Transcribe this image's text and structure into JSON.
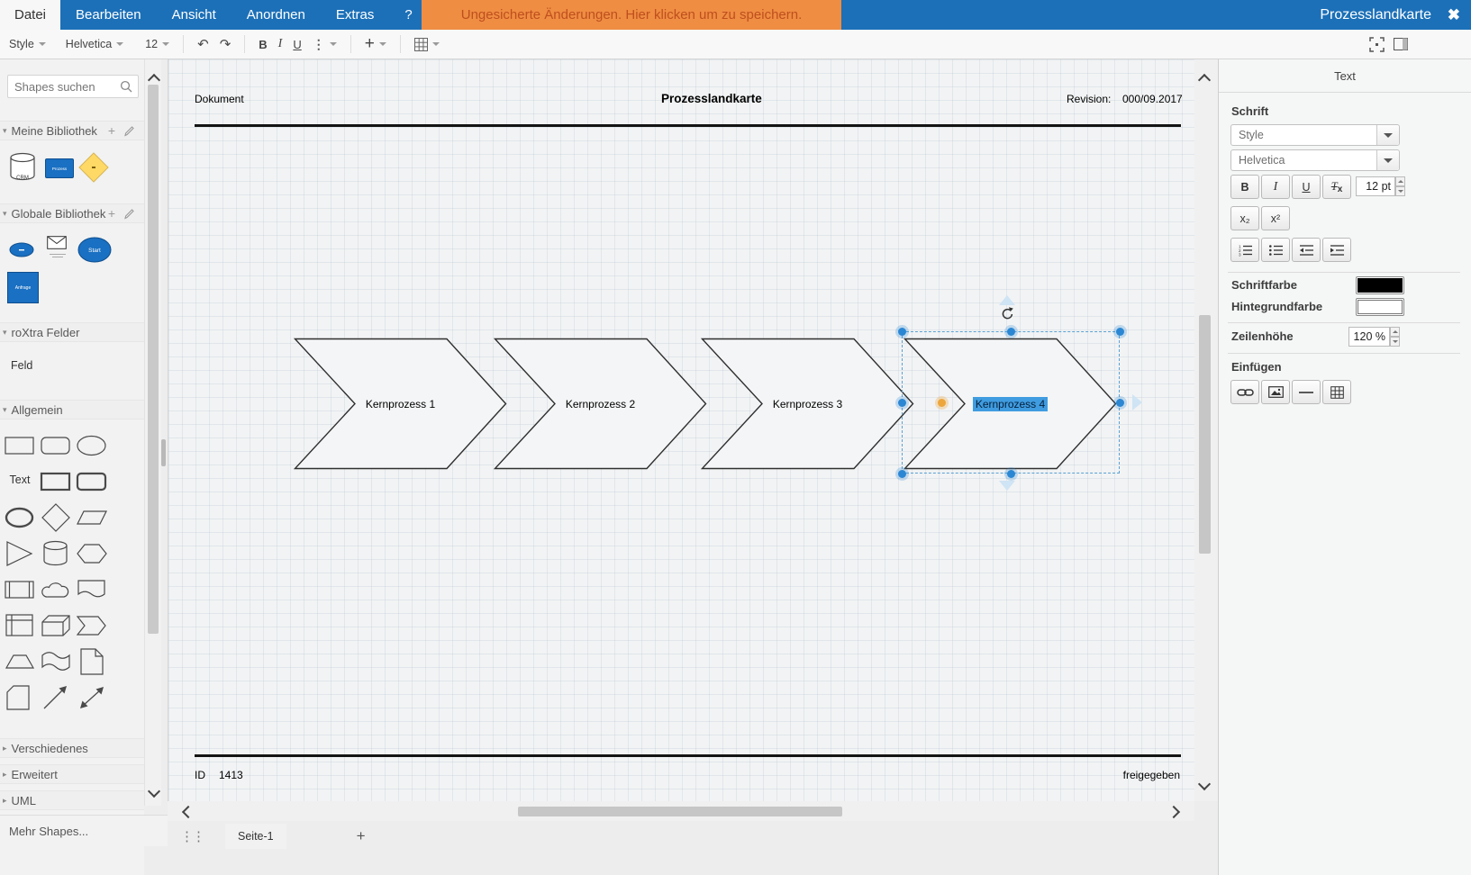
{
  "menu": {
    "datei": "Datei",
    "bearbeiten": "Bearbeiten",
    "ansicht": "Ansicht",
    "anordnen": "Anordnen",
    "extras": "Extras",
    "help": "?"
  },
  "warning": "Ungesicherte Änderungen. Hier klicken um zu speichern.",
  "window_title": "Prozesslandkarte",
  "toolbar": {
    "style": "Style",
    "font": "Helvetica",
    "size": "12",
    "bold": "B",
    "italic": "I",
    "underline": "U"
  },
  "sidebar": {
    "search_placeholder": "Shapes suchen",
    "sections": {
      "meine": "Meine Bibliothek",
      "globale": "Globale Bibliothek",
      "roxtra": "roXtra Felder",
      "allgemein": "Allgemein",
      "verschiedenes": "Verschiedenes",
      "erweitert": "Erweitert",
      "uml": "UML"
    },
    "feld": "Feld",
    "mehr_shapes": "Mehr Shapes...",
    "text_shape": "Text",
    "library_labels": {
      "crm": "CRM",
      "prozess": "Prozess",
      "start": "Start",
      "anfrage": "Anfrage"
    },
    "allgemein_shapes": [
      "rectangle",
      "rounded-rectangle",
      "ellipse",
      "text",
      "rectangle-bold",
      "rounded-rectangle-bold",
      "ellipse-bold",
      "diamond",
      "parallelogram",
      "triangle",
      "cylinder",
      "hexagon",
      "process",
      "cloud",
      "document",
      "internal-storage",
      "cube",
      "step",
      "trapezoid",
      "tape",
      "note",
      "card",
      "arrow",
      "bidirectional-arrow"
    ]
  },
  "canvas": {
    "doc_label": "Dokument",
    "title": "Prozesslandkarte",
    "revision_label": "Revision:",
    "revision_value": "000/09.2017",
    "id_label": "ID",
    "id_value": "1413",
    "status": "freigegeben",
    "chevrons": [
      {
        "label": "Kernprozess 1"
      },
      {
        "label": "Kernprozess 2"
      },
      {
        "label": "Kernprozess 3"
      },
      {
        "label": "Kernprozess 4",
        "selected": true
      }
    ]
  },
  "pages": {
    "tab": "Seite-1",
    "add": "+"
  },
  "panel": {
    "title": "Text",
    "schrift": "Schrift",
    "style_value": "Style",
    "font_value": "Helvetica",
    "size_value": "12 pt",
    "bold": "B",
    "italic": "I",
    "underline": "U",
    "clear_t": "T",
    "clear_x": "x",
    "subscript": "x₂",
    "superscript": "x²",
    "schriftfarbe": "Schriftfarbe",
    "hintergrundfarbe": "Hintegrundfarbe",
    "zeilenhoehe": "Zeilenhöhe",
    "zeilenhoehe_value": "120 %",
    "einfuegen": "Einfügen"
  },
  "colors": {
    "menubar_blue": "#1c70b8",
    "warning_bg": "#ef8d43",
    "warning_text": "#bf4f1d",
    "library_blue": "#1a70c2",
    "library_yellow": "#ffd966",
    "selection_dash": "#5aa2d4",
    "handle_blue": "#2b87d3",
    "handle_orange": "#eca63b",
    "text_highlight": "#3f9ce0"
  }
}
